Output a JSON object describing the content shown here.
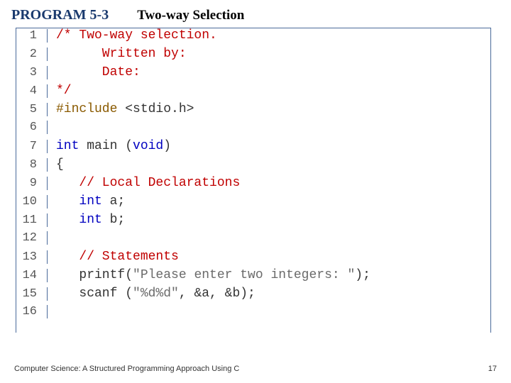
{
  "header": {
    "program_label": "PROGRAM 5-3",
    "title": "Two-way Selection"
  },
  "code": {
    "lines": [
      {
        "n": "1",
        "tokens": [
          {
            "cls": "tok-comment",
            "t": "/* Two-way selection."
          }
        ]
      },
      {
        "n": "2",
        "tokens": [
          {
            "cls": "tok-comment",
            "t": "      Written by:"
          }
        ]
      },
      {
        "n": "3",
        "tokens": [
          {
            "cls": "tok-comment",
            "t": "      Date:"
          }
        ]
      },
      {
        "n": "4",
        "tokens": [
          {
            "cls": "tok-comment",
            "t": "*/"
          }
        ]
      },
      {
        "n": "5",
        "tokens": [
          {
            "cls": "tok-pp",
            "t": "#include "
          },
          {
            "cls": "tok-plain",
            "t": "<stdio.h>"
          }
        ]
      },
      {
        "n": "6",
        "tokens": []
      },
      {
        "n": "7",
        "tokens": [
          {
            "cls": "tok-kw",
            "t": "int "
          },
          {
            "cls": "tok-plain",
            "t": "main ("
          },
          {
            "cls": "tok-kw",
            "t": "void"
          },
          {
            "cls": "tok-plain",
            "t": ")"
          }
        ]
      },
      {
        "n": "8",
        "tokens": [
          {
            "cls": "tok-plain",
            "t": "{"
          }
        ]
      },
      {
        "n": "9",
        "tokens": [
          {
            "cls": "tok-plain",
            "t": "   "
          },
          {
            "cls": "tok-comment",
            "t": "// Local Declarations"
          }
        ]
      },
      {
        "n": "10",
        "tokens": [
          {
            "cls": "tok-plain",
            "t": "   "
          },
          {
            "cls": "tok-kw",
            "t": "int "
          },
          {
            "cls": "tok-plain",
            "t": "a;"
          }
        ]
      },
      {
        "n": "11",
        "tokens": [
          {
            "cls": "tok-plain",
            "t": "   "
          },
          {
            "cls": "tok-kw",
            "t": "int "
          },
          {
            "cls": "tok-plain",
            "t": "b;"
          }
        ]
      },
      {
        "n": "12",
        "tokens": []
      },
      {
        "n": "13",
        "tokens": [
          {
            "cls": "tok-plain",
            "t": "   "
          },
          {
            "cls": "tok-comment",
            "t": "// Statements"
          }
        ]
      },
      {
        "n": "14",
        "tokens": [
          {
            "cls": "tok-plain",
            "t": "   printf("
          },
          {
            "cls": "tok-str",
            "t": "\"Please enter two integers: \""
          },
          {
            "cls": "tok-plain",
            "t": ");"
          }
        ]
      },
      {
        "n": "15",
        "tokens": [
          {
            "cls": "tok-plain",
            "t": "   scanf ("
          },
          {
            "cls": "tok-str",
            "t": "\"%d%d\""
          },
          {
            "cls": "tok-plain",
            "t": ", &a, &b);"
          }
        ]
      },
      {
        "n": "16",
        "tokens": []
      }
    ]
  },
  "footer": {
    "left": "Computer Science: A Structured Programming Approach Using C",
    "right": "17"
  }
}
